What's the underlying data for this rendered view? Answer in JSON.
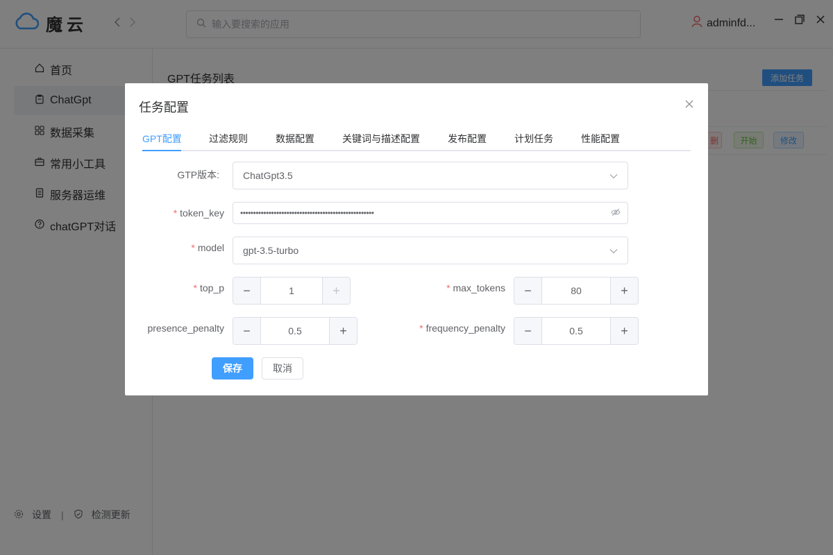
{
  "app": {
    "name": "魔云"
  },
  "search": {
    "placeholder": "输入要搜索的应用"
  },
  "user": {
    "name": "adminfd..."
  },
  "sidebar": {
    "items": [
      {
        "label": "首页",
        "icon": "home-icon"
      },
      {
        "label": "ChatGpt",
        "icon": "clipboard-icon"
      },
      {
        "label": "数据采集",
        "icon": "grid-icon"
      },
      {
        "label": "常用小工具",
        "icon": "briefcase-icon"
      },
      {
        "label": "服务器运维",
        "icon": "document-icon"
      },
      {
        "label": "chatGPT对话",
        "icon": "question-icon"
      }
    ],
    "footer": {
      "settings": "设置",
      "check_update": "检测更新"
    }
  },
  "main": {
    "title": "GPT任务列表",
    "add_button": "添加任务",
    "row_actions": {
      "delete": "删",
      "start": "开始",
      "edit": "修改"
    }
  },
  "dialog": {
    "title": "任务配置",
    "tabs": [
      "GPT配置",
      "过滤规则",
      "数据配置",
      "关键词与描述配置",
      "发布配置",
      "计划任务",
      "性能配置"
    ],
    "active_tab": 0,
    "fields": {
      "gtp_version": {
        "label": "GTP版本:",
        "value": "ChatGpt3.5"
      },
      "token_key": {
        "label": "token_key",
        "value": "••••••••••••••••••••••••••••••••••••••••••••••••••••",
        "required": true
      },
      "model": {
        "label": "model",
        "value": "gpt-3.5-turbo",
        "required": true
      },
      "top_p": {
        "label": "top_p",
        "value": "1",
        "required": true
      },
      "max_tokens": {
        "label": "max_tokens",
        "value": "80",
        "required": true
      },
      "presence_penalty": {
        "label": "presence_penalty",
        "value": "0.5"
      },
      "frequency_penalty": {
        "label": "frequency_penalty",
        "value": "0.5",
        "required": true
      }
    },
    "save_label": "保存",
    "cancel_label": "取消",
    "stepper": {
      "minus": "−",
      "plus": "+"
    },
    "required_mark": "*"
  },
  "colors": {
    "primary": "#409eff",
    "danger": "#f56c6c",
    "success": "#67c23a"
  }
}
